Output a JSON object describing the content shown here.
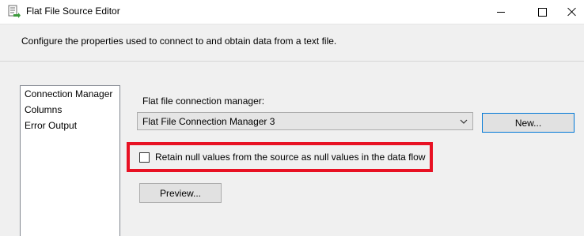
{
  "window": {
    "title": "Flat File Source Editor",
    "icon": "data-source-icon"
  },
  "header": {
    "description": "Configure the properties used to connect to and obtain data from a text file."
  },
  "nav": {
    "items": [
      {
        "label": "Connection Manager"
      },
      {
        "label": "Columns"
      },
      {
        "label": "Error Output"
      }
    ]
  },
  "main": {
    "connection_label": "Flat file connection manager:",
    "connection_value": "Flat File Connection Manager 3",
    "new_button": "New...",
    "retain_null_label": "Retain null values from the source as null values in the data flow",
    "retain_null_checked": false,
    "preview_button": "Preview..."
  },
  "colors": {
    "highlight": "#e81123",
    "focus_border": "#0078d7"
  }
}
